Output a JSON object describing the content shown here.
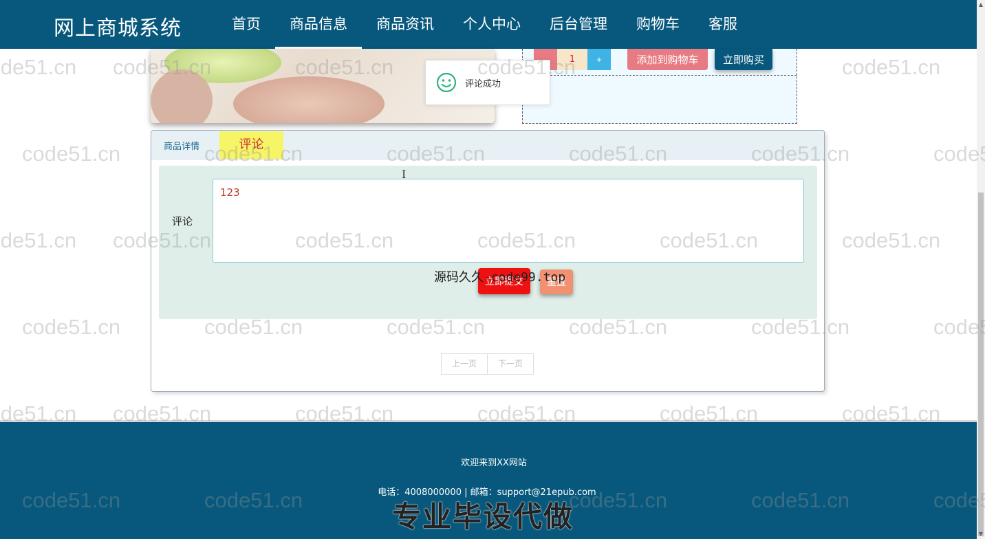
{
  "header": {
    "logo": "网上商城系统",
    "nav": [
      {
        "label": "首页"
      },
      {
        "label": "商品信息",
        "active": true
      },
      {
        "label": "商品资讯"
      },
      {
        "label": "个人中心"
      },
      {
        "label": "后台管理"
      },
      {
        "label": "购物车"
      },
      {
        "label": "客服"
      }
    ]
  },
  "buy_panel": {
    "minus_label": "-",
    "quantity": "1",
    "plus_label": "+",
    "add_to_cart_label": "添加到购物车",
    "buy_now_label": "立即购买"
  },
  "toast": {
    "message": "评论成功",
    "icon": "smiley-icon"
  },
  "tabs": {
    "detail_label": "商品详情",
    "comment_label": "评论"
  },
  "comment_form": {
    "label": "评论",
    "value": "123",
    "submit_label": "立即提交",
    "reset_label": "重置"
  },
  "overlay_text": "源码久久-code99.top",
  "pager": {
    "prev_label": "上一页",
    "next_label": "下一页"
  },
  "footer": {
    "welcome": "欢迎来到XX网站",
    "contact": "电话：4008000000 | 邮箱：support@21epub.com",
    "banner": "专业毕设代做"
  },
  "watermark_text": "code51.cn",
  "colors": {
    "primary": "#07587c",
    "comment_tab_bg": "#f6f566",
    "submit": "#ee1111",
    "reset": "#f29072",
    "add_cart": "#e77a82",
    "plus": "#3fb3e3"
  }
}
